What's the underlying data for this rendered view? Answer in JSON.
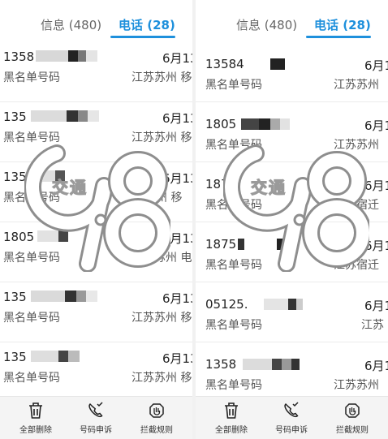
{
  "panels": [
    {
      "tabs": [
        {
          "label": "信息 (480)"
        },
        {
          "label": "电话 (28)"
        }
      ],
      "rows": [
        {
          "number": "1358",
          "tag": "黑名单号码",
          "date": "6月13",
          "location": "江苏苏州 移"
        },
        {
          "number": "135",
          "tag": "黑名单号码",
          "date": "6月13",
          "location": "江苏苏州 移"
        },
        {
          "number": "135",
          "tag": "黑名单号码",
          "date": "6月13",
          "location": "苏州 移"
        },
        {
          "number": "1805",
          "tag": "黑名单号码",
          "date": "6月13",
          "location": "江苏苏州 电"
        },
        {
          "number": "135",
          "tag": "黑名单号码",
          "date": "6月13",
          "location": "江苏苏州 移"
        },
        {
          "number": "135",
          "tag": "黑名单号码",
          "date": "6月13",
          "location": "江苏苏州 移"
        }
      ],
      "bottom": {
        "delete_all": "全部删除",
        "complain": "号码申诉",
        "rules": "拦截规则"
      }
    },
    {
      "tabs": [
        {
          "label": "信息 (480)"
        },
        {
          "label": "电话 (28)"
        }
      ],
      "rows": [
        {
          "number": "13584",
          "tag": "黑名单号码",
          "date": "6月1",
          "location": "江苏苏州 "
        },
        {
          "number": "1805",
          "tag": "黑名单号码",
          "date": "6月1",
          "location": "江苏苏州 "
        },
        {
          "number": "187",
          "tag": "黑名单号码",
          "date": "6月1",
          "location": "江苏宿迁 "
        },
        {
          "number": "1875",
          "tag": "黑名单号码",
          "date": "6月1",
          "location": "江苏宿迁 "
        },
        {
          "number": "05125.",
          "tag": "黑名单号码",
          "date": "6月1",
          "location": "江苏"
        },
        {
          "number": "1358",
          "tag": "黑名单号码",
          "date": "6月1",
          "location": "江苏苏州 "
        }
      ],
      "bottom": {
        "delete_all": "全部删除",
        "complain": "号码申诉",
        "rules": "拦截规则"
      }
    }
  ],
  "watermark": {
    "text": "交通",
    "number": "9.8",
    "color": "#9a9a9a"
  },
  "colors": {
    "accent": "#1e90dc",
    "divider": "#ececec",
    "bottom_bar": "#f4f4f4"
  },
  "icons": {
    "delete_all": "trash-icon",
    "complain": "phone-complaint-icon",
    "rules": "hand-block-icon"
  }
}
